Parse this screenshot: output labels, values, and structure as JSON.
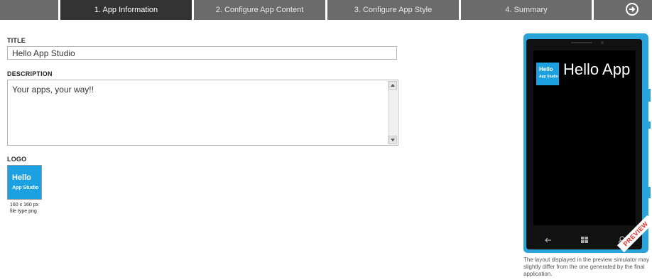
{
  "wizard": {
    "steps": [
      {
        "label": ""
      },
      {
        "label": "1. App Information"
      },
      {
        "label": "2. Configure App Content"
      },
      {
        "label": "3. Configure App Style"
      },
      {
        "label": "4. Summary"
      }
    ],
    "next_icon": "arrow-right-circle-icon"
  },
  "form": {
    "title_label": "TITLE",
    "title_value": "Hello App Studio",
    "description_label": "DESCRIPTION",
    "description_value": "Your apps, your way!!",
    "logo_label": "LOGO",
    "logo_tile": {
      "line1": "Hello",
      "line2": "App Studio"
    },
    "logo_size": "160 x 160 px",
    "logo_type": "file type png"
  },
  "preview": {
    "tile": {
      "line1": "Hello",
      "line2": "App Studio"
    },
    "app_title": "Hello App",
    "ribbon": "PREVIEW",
    "note": "The layout displayed in the preview simulator may slightly differ from the one generated by the final application."
  },
  "colors": {
    "accent": "#1ba1e2",
    "phone": "#2aa3da",
    "nav_active": "#333333",
    "nav_inactive": "#6b6b6b",
    "ribbon_text": "#d9302b"
  }
}
